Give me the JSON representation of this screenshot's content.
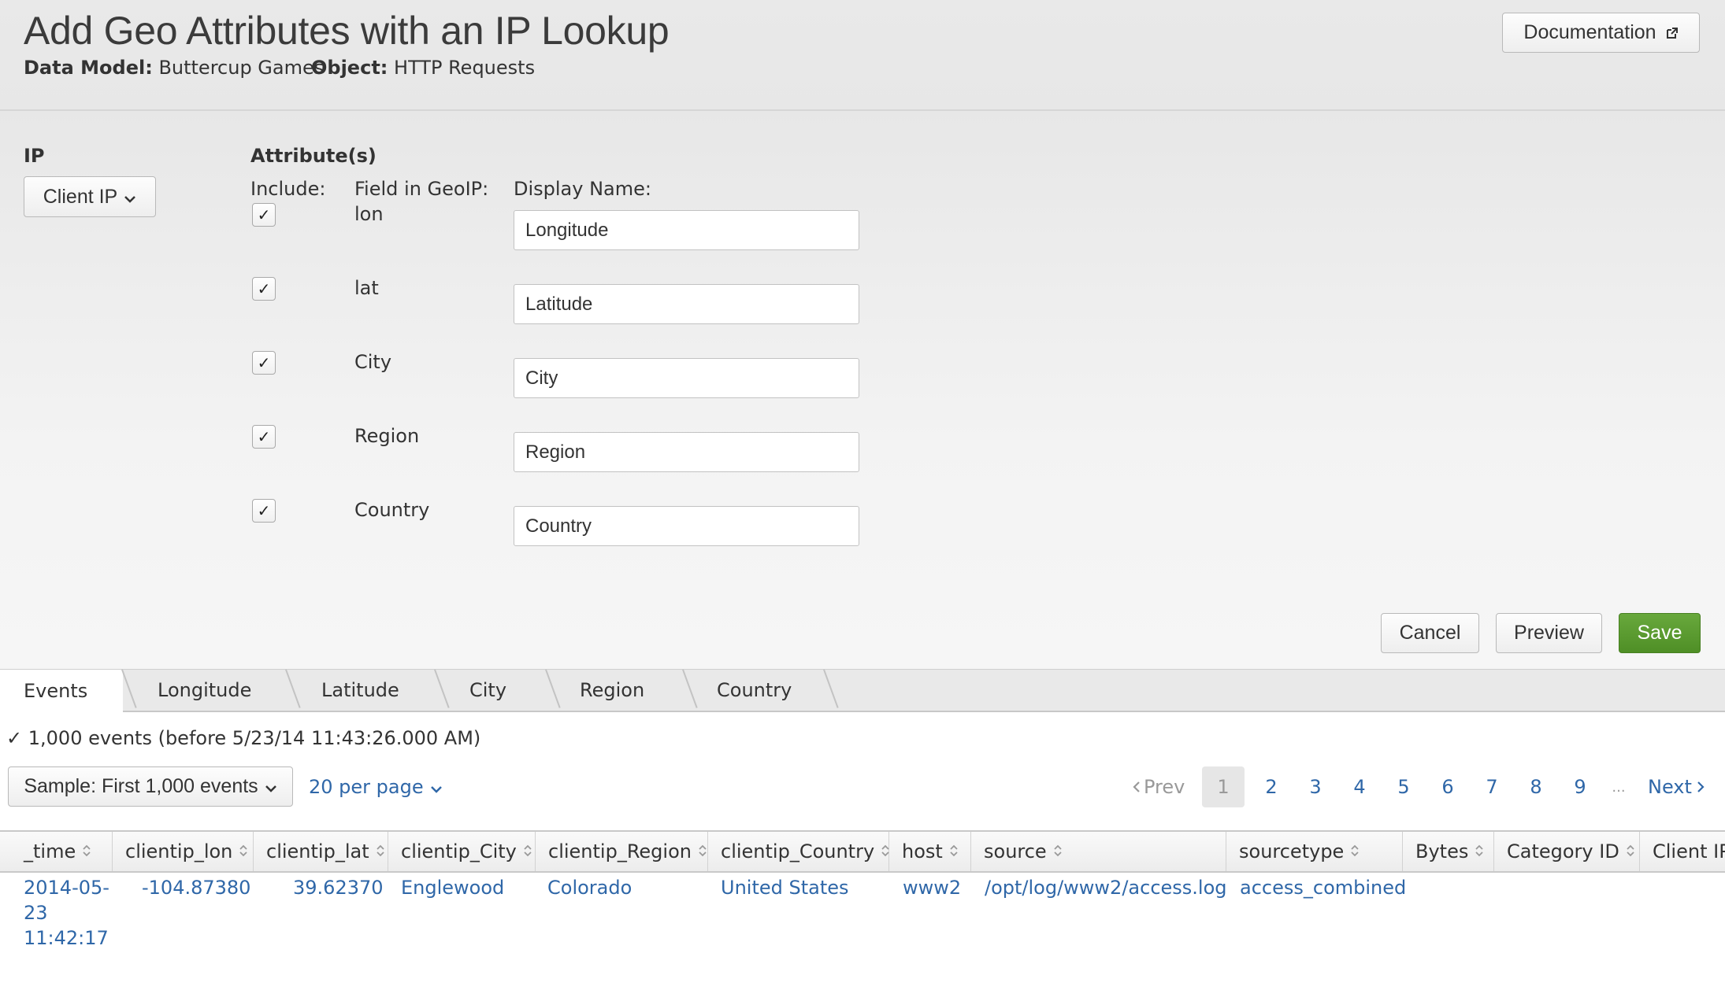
{
  "header": {
    "title": "Add Geo Attributes with an IP Lookup",
    "data_model_label": "Data Model:",
    "data_model_value": "Buttercup Games",
    "object_label": "Object:",
    "object_value": "HTTP Requests",
    "documentation_label": "Documentation"
  },
  "form": {
    "ip_label": "IP",
    "ip_select_value": "Client IP",
    "attributes_label": "Attribute(s)",
    "include_label": "Include:",
    "field_label": "Field in GeoIP:",
    "display_name_label": "Display Name:",
    "rows": [
      {
        "checked": true,
        "field": "lon",
        "display_name": "Longitude"
      },
      {
        "checked": true,
        "field": "lat",
        "display_name": "Latitude"
      },
      {
        "checked": true,
        "field": "City",
        "display_name": "City"
      },
      {
        "checked": true,
        "field": "Region",
        "display_name": "Region"
      },
      {
        "checked": true,
        "field": "Country",
        "display_name": "Country"
      }
    ],
    "cancel_label": "Cancel",
    "preview_label": "Preview",
    "save_label": "Save",
    "save_color": "#5a9a2f"
  },
  "tabs": [
    "Events",
    "Longitude",
    "Latitude",
    "City",
    "Region",
    "Country"
  ],
  "status": {
    "check": "✓",
    "text": "1,000 events (before 5/23/14 11:43:26.000 AM)"
  },
  "controls": {
    "sample_label": "Sample: First 1,000 events",
    "per_page_label": "20 per page"
  },
  "pager": {
    "prev_label": "Prev",
    "pages": [
      "1",
      "2",
      "3",
      "4",
      "5",
      "6",
      "7",
      "8",
      "9"
    ],
    "current_page": "1",
    "ellipsis": "...",
    "next_label": "Next"
  },
  "table": {
    "columns": [
      "_time",
      "clientip_lon",
      "clientip_lat",
      "clientip_City",
      "clientip_Region",
      "clientip_Country",
      "host",
      "source",
      "sourcetype",
      "Bytes",
      "Category ID",
      "Client IP"
    ],
    "rows": [
      {
        "time_lines": [
          "2014-05-",
          "23",
          "11:42:17"
        ],
        "clientip_lon": "-104.87380",
        "clientip_lat": "39.62370",
        "clientip_City": "Englewood",
        "clientip_Region": "Colorado",
        "clientip_Country": "United States",
        "host": "www2",
        "source": "/opt/log/www2/access.log",
        "sourcetype": "access_combined"
      }
    ]
  },
  "colors": {
    "link": "#2f67a8",
    "primary_button": "#5a9a2f"
  }
}
